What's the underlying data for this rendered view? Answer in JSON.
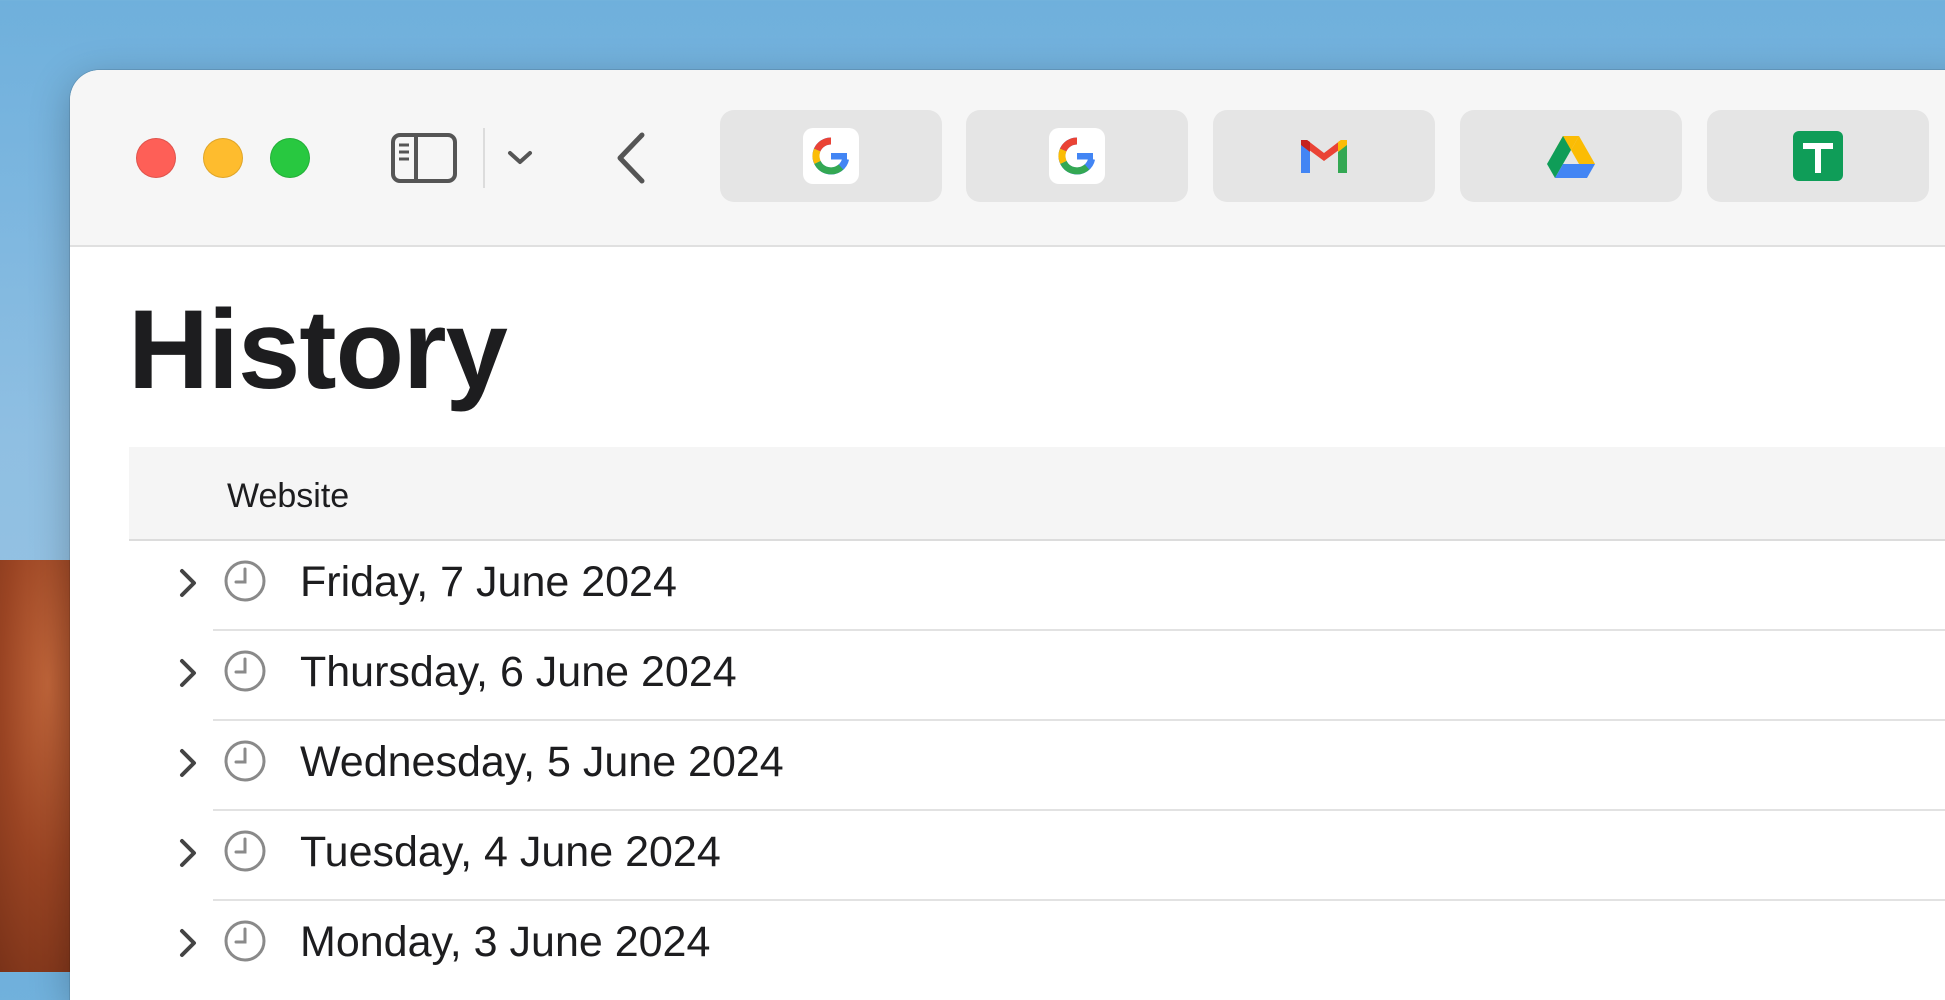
{
  "toolbar": {
    "tabs": [
      {
        "site": "Google",
        "icon": "google-icon"
      },
      {
        "site": "Google",
        "icon": "google-icon"
      },
      {
        "site": "Gmail",
        "icon": "gmail-icon"
      },
      {
        "site": "Google Drive",
        "icon": "google-drive-icon"
      },
      {
        "site": "Google Sheets",
        "icon": "google-sheets-icon"
      }
    ]
  },
  "page": {
    "title": "History",
    "column_header": "Website"
  },
  "history": {
    "rows": [
      {
        "date": "Friday, 7 June 2024"
      },
      {
        "date": "Thursday, 6 June 2024"
      },
      {
        "date": "Wednesday, 5 June 2024"
      },
      {
        "date": "Tuesday, 4 June 2024"
      },
      {
        "date": "Monday, 3 June 2024"
      }
    ]
  },
  "colors": {
    "close": "#fe5f57",
    "minimize": "#febc2e",
    "zoom": "#28c840",
    "text": "#1d1d1f"
  }
}
